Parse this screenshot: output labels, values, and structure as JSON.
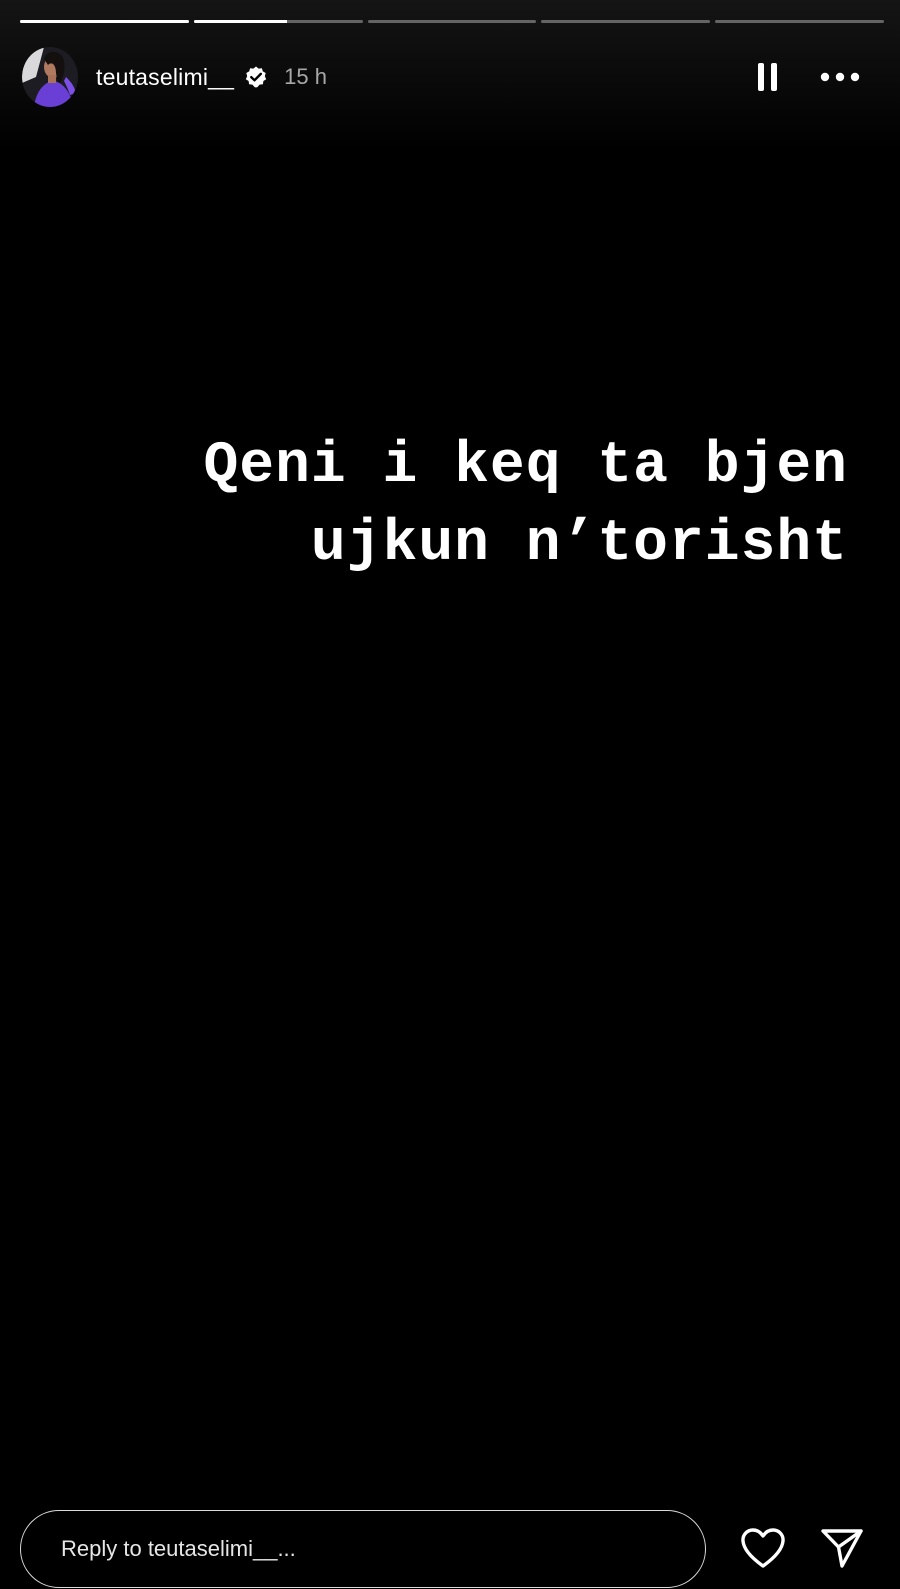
{
  "story": {
    "progress_segments": [
      1,
      0.55,
      0,
      0,
      0
    ],
    "user": {
      "username": "teutaselimi__",
      "verified": true,
      "time_ago": "15 h"
    },
    "text_line_1": "Qeni i keq ta bjen",
    "text_line_2": "ujkun n’torisht",
    "background_color": "#000000"
  },
  "header": {
    "pause_icon": "pause-icon",
    "more_icon": "more-options-icon"
  },
  "footer": {
    "reply_placeholder": "Reply to teutaselimi__...",
    "like_icon": "heart-icon",
    "share_icon": "send-icon"
  }
}
